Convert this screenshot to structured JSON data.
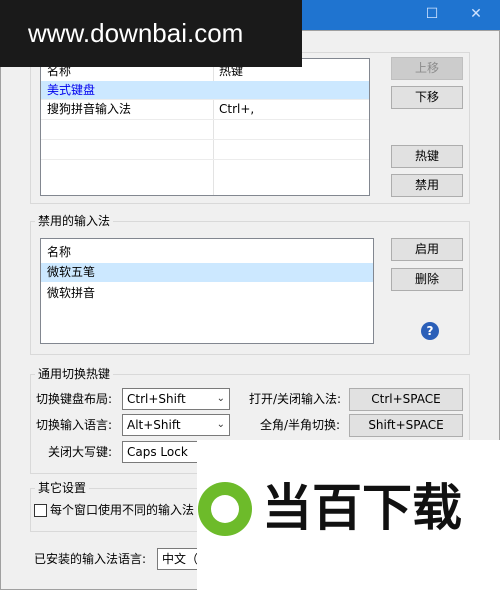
{
  "window": {
    "maximize_glyph": "☐",
    "close_glyph": "✕"
  },
  "watermark_text": "www.downbai.com",
  "enabled_ime": {
    "columns": [
      "名称",
      "热键"
    ],
    "rows": [
      {
        "name": "美式键盘",
        "hotkey": ""
      },
      {
        "name": "搜狗拼音输入法",
        "hotkey": "Ctrl+,"
      }
    ],
    "buttons": {
      "up": "上移",
      "down": "下移",
      "hotkey": "热键",
      "disable": "禁用"
    }
  },
  "disabled_ime": {
    "title": "禁用的输入法",
    "column": "名称",
    "rows": [
      "微软五笔",
      "微软拼音"
    ],
    "buttons": {
      "enable": "启用",
      "delete": "删除"
    },
    "help_glyph": "?"
  },
  "hotkeys": {
    "title": "通用切换热键",
    "layout_label": "切换键盘布局:",
    "layout_value": "Ctrl+Shift",
    "language_label": "切换输入语言:",
    "language_value": "Alt+Shift",
    "caps_label": "关闭大写键:",
    "caps_value": "Caps Lock",
    "toggle_label": "打开/关闭输入法:",
    "toggle_value": "Ctrl+SPACE",
    "width_label": "全角/半角切换:",
    "width_value": "Shift+SPACE"
  },
  "other": {
    "title": "其它设置",
    "per_window_label": "每个窗口使用不同的输入法"
  },
  "installed": {
    "label": "已安装的输入法语言:",
    "value": "中文（"
  },
  "logo": {
    "text": "当百下载",
    "color": "#6dbb2a"
  }
}
